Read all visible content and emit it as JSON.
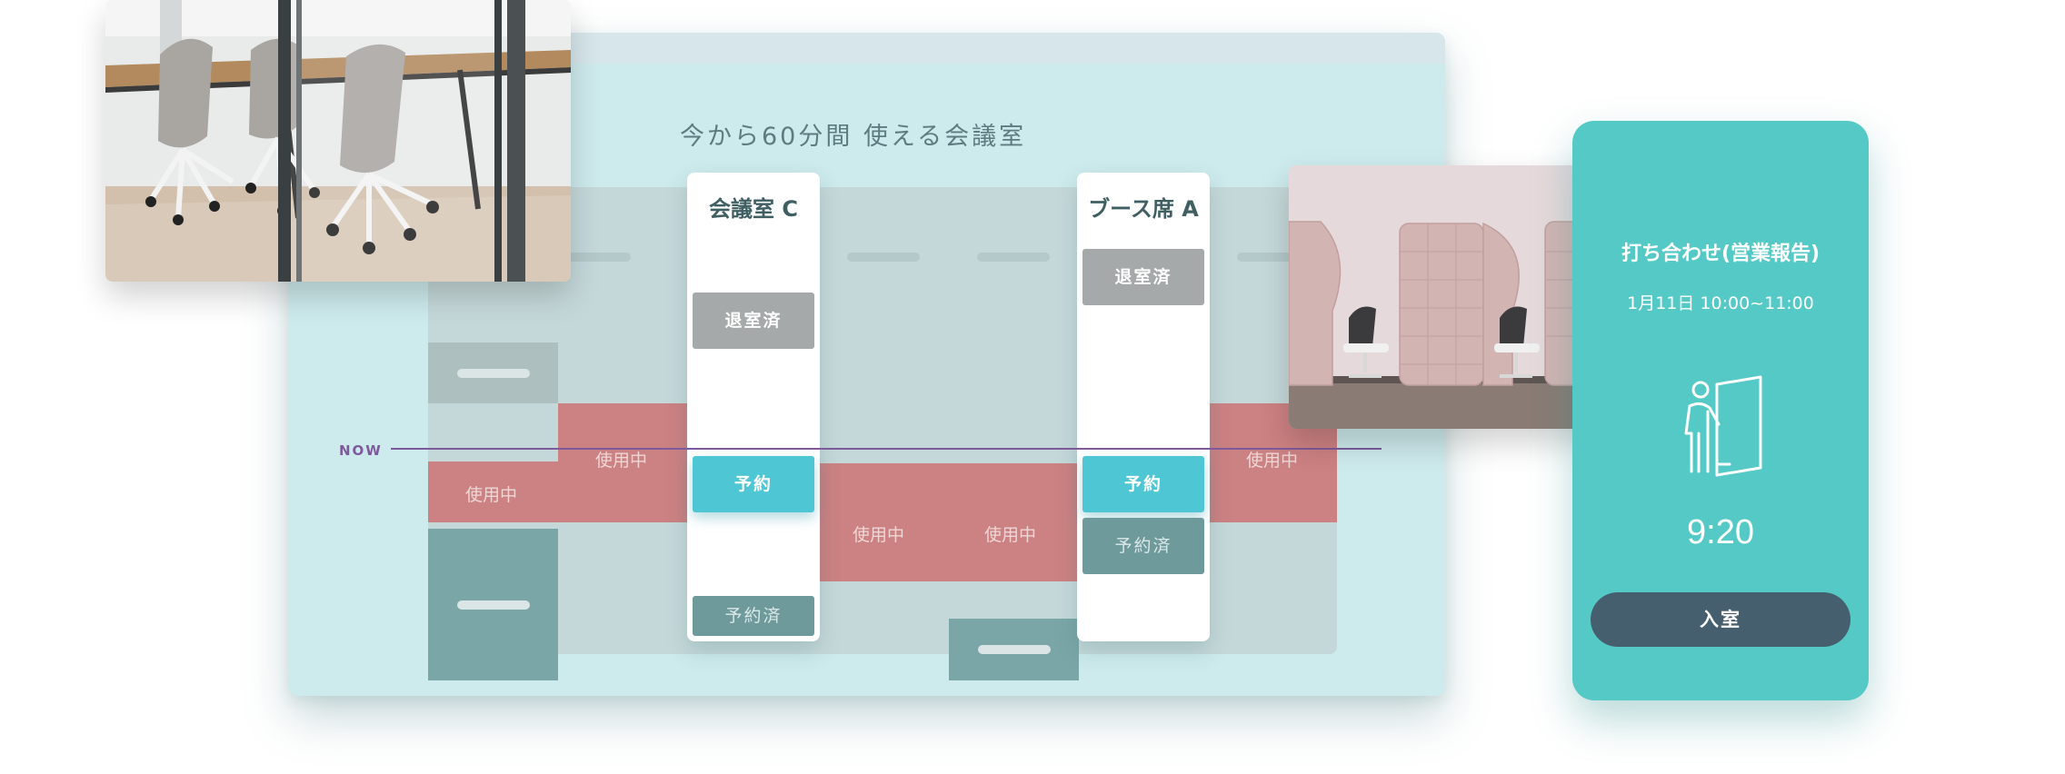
{
  "schedule": {
    "title": "今から60分間 使える会議室",
    "now_label": "NOW",
    "in_use_label": "使用中",
    "rooms": [
      {
        "name": "会議室 C",
        "checked_out_label": "退室済",
        "reserve_label": "予約",
        "reserved_label": "予約済"
      },
      {
        "name": "ブース席 A",
        "checked_out_label": "退室済",
        "reserve_label": "予約",
        "reserved_label": "予約済"
      }
    ]
  },
  "mobile": {
    "meeting_title": "打ち合わせ(営業報告)",
    "date_time": "1月11日 10:00~11:00",
    "current_time": "9:20",
    "enter_button": "入室",
    "icon": "person-entering-door-icon"
  },
  "colors": {
    "accent_teal": "#55c9c5",
    "reserve_cyan": "#4fc6d4",
    "in_use_red": "#cc8182",
    "now_purple": "#7e5a9c",
    "enter_button": "#455f6e"
  }
}
